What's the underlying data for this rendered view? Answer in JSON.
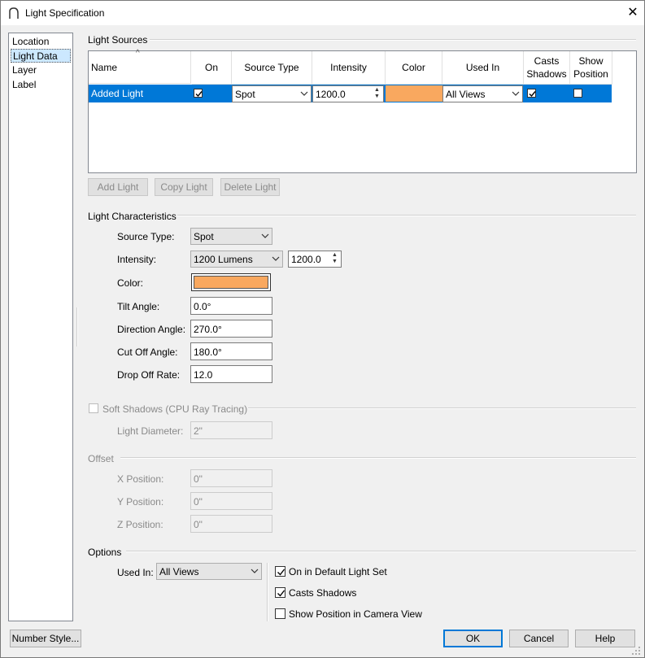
{
  "window": {
    "title": "Light Specification",
    "close_glyph": "✕"
  },
  "nav": {
    "items": [
      {
        "label": "Location",
        "selected": false
      },
      {
        "label": "Light Data",
        "selected": true
      },
      {
        "label": "Layer",
        "selected": false
      },
      {
        "label": "Label",
        "selected": false
      }
    ]
  },
  "light_sources": {
    "title": "Light Sources",
    "sort_glyph": "^",
    "columns": [
      "Name",
      "On",
      "Source Type",
      "Intensity",
      "Color",
      "Used In",
      "Casts Shadows",
      "Show Position"
    ],
    "rows": [
      {
        "name": "Added Light",
        "on": true,
        "source_type": "Spot",
        "intensity": "1200.0",
        "color": "#f9a85f",
        "used_in": "All Views",
        "casts_shadows": true,
        "show_position": false
      }
    ],
    "buttons": {
      "add": "Add Light",
      "copy": "Copy Light",
      "delete": "Delete Light"
    }
  },
  "characteristics": {
    "title": "Light Characteristics",
    "source_type_label": "Source Type:",
    "source_type_value": "Spot",
    "intensity_label": "Intensity:",
    "intensity_unit": "1200 Lumens",
    "intensity_value": "1200.0",
    "color_label": "Color:",
    "color_value": "#f9a85f",
    "tilt_label": "Tilt Angle:",
    "tilt_value": "0.0°",
    "direction_label": "Direction Angle:",
    "direction_value": "270.0°",
    "cutoff_label": "Cut Off Angle:",
    "cutoff_value": "180.0°",
    "dropoff_label": "Drop Off Rate:",
    "dropoff_value": "12.0"
  },
  "soft_shadows": {
    "label": "Soft Shadows (CPU Ray Tracing)",
    "checked": false,
    "diameter_label": "Light Diameter:",
    "diameter_value": "2\""
  },
  "offset": {
    "title": "Offset",
    "x_label": "X Position:",
    "x_value": "0\"",
    "y_label": "Y Position:",
    "y_value": "0\"",
    "z_label": "Z Position:",
    "z_value": "0\""
  },
  "options": {
    "title": "Options",
    "used_in_label": "Used In:",
    "used_in_value": "All Views",
    "default_set_label": "On in Default Light Set",
    "default_set_checked": true,
    "casts_shadows_label": "Casts Shadows",
    "casts_shadows_checked": true,
    "show_position_label": "Show Position in Camera View",
    "show_position_checked": false
  },
  "footer": {
    "number_style": "Number Style...",
    "ok": "OK",
    "cancel": "Cancel",
    "help": "Help"
  },
  "colors": {
    "accent": "#0078d7",
    "selection_row": "#0078d7",
    "light_color": "#f9a85f",
    "nav_selected": "#cce8ff"
  },
  "icons": {
    "app": "arch-icon",
    "spin_up": "▲",
    "spin_down": "▼"
  }
}
